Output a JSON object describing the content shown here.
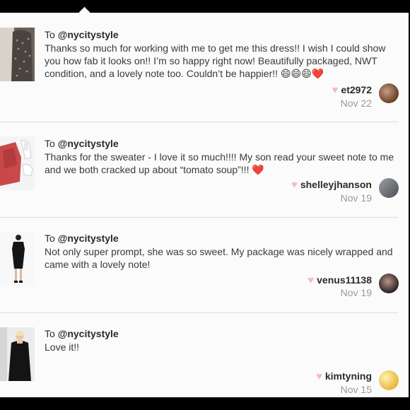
{
  "reviews": [
    {
      "to_prefix": "To ",
      "to_handle": "@nycitystyle",
      "message": "Thanks so much for working with me to get me this dress!! I wish I could show you how fab it looks on!! I’m so happy right now! Beautifully packaged, NWT condition, and a lovely note too. Couldn’t be happier!! 😄😄😄❤️",
      "username": "et2972",
      "date": "Nov 22",
      "like_icon": "heart-icon"
    },
    {
      "to_prefix": "To ",
      "to_handle": "@nycitystyle",
      "message": "Thanks for the sweater - I love it so much!!!! My son read your sweet note to me and we both cracked up about “tomato soup”!!! ❤️",
      "username": "shelleyjhanson",
      "date": "Nov 19",
      "like_icon": "heart-icon"
    },
    {
      "to_prefix": "To ",
      "to_handle": "@nycitystyle",
      "message": "Not only super prompt, she was so sweet. My package was nicely wrapped and came with a lovely note!",
      "username": "venus11138",
      "date": "Nov 19",
      "like_icon": "heart-icon"
    },
    {
      "to_prefix": "To ",
      "to_handle": "@nycitystyle",
      "message": "Love it!!",
      "username": "kimtyning",
      "date": "Nov 15",
      "like_icon": "heart-icon"
    }
  ],
  "colors": {
    "heart": "#f3bcc1",
    "date": "#9a9a9a",
    "text": "#3a3a3a",
    "divider": "#dedede"
  }
}
